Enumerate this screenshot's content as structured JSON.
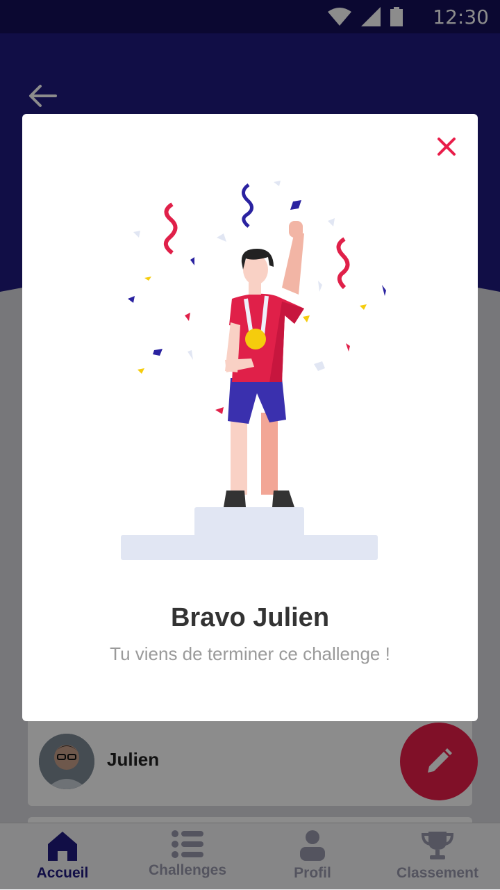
{
  "status_bar": {
    "time": "12:30"
  },
  "user": {
    "name": "Julien"
  },
  "modal": {
    "title": "Bravo Julien",
    "subtitle": "Tu viens de terminer ce  challenge !"
  },
  "bottom_nav": {
    "items": [
      {
        "label": "Accueil",
        "icon": "home-icon",
        "active": true
      },
      {
        "label": "Challenges",
        "icon": "list-icon",
        "active": false
      },
      {
        "label": "Profil",
        "icon": "person-icon",
        "active": false
      },
      {
        "label": "Classement",
        "icon": "trophy-icon",
        "active": false
      }
    ]
  },
  "colors": {
    "primary": "#1f1a80",
    "accent": "#e91e4a",
    "modal_bg": "#ffffff"
  }
}
